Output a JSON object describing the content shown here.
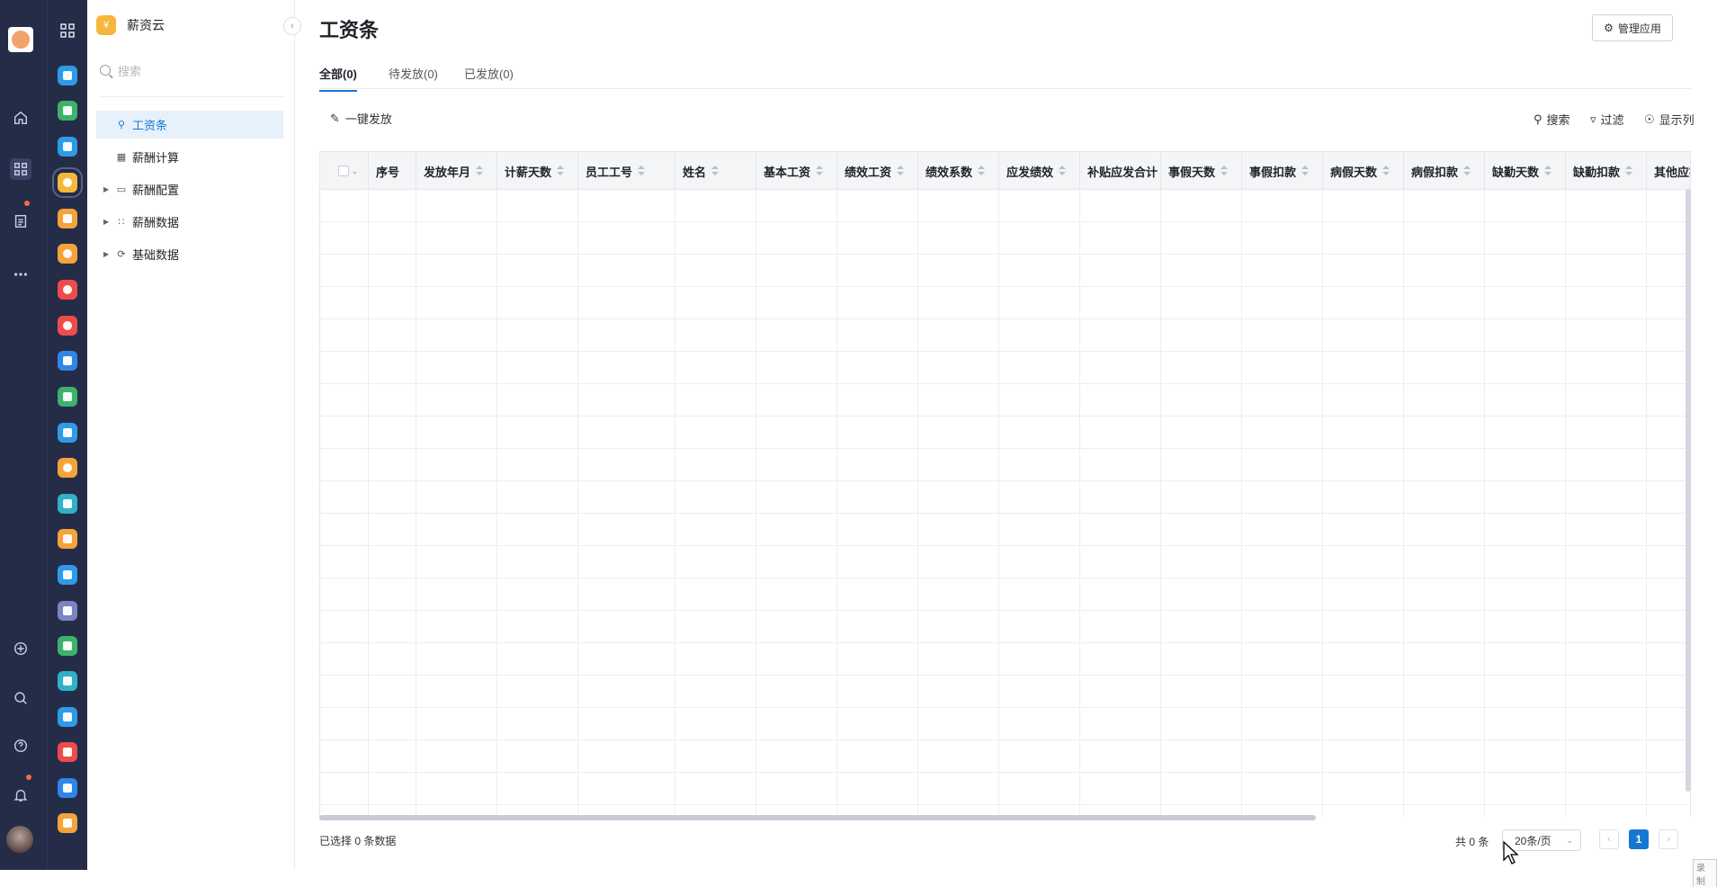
{
  "app": {
    "name": "薪资云",
    "logo_letter": "¥"
  },
  "sidebar": {
    "search_placeholder": "搜索",
    "items": [
      {
        "label": "工资条",
        "active": true,
        "icon": "circle-currency-icon"
      },
      {
        "label": "薪酬计算",
        "active": false,
        "icon": "calculator-icon"
      },
      {
        "label": "薪酬配置",
        "active": false,
        "icon": "config-icon",
        "expandable": true
      },
      {
        "label": "薪酬数据",
        "active": false,
        "icon": "data-icon",
        "expandable": true
      },
      {
        "label": "基础数据",
        "active": false,
        "icon": "refresh-icon",
        "expandable": true
      }
    ]
  },
  "page": {
    "title": "工资条",
    "manage_button": "管理应用",
    "tabs": [
      {
        "label": "全部(0)",
        "active": true
      },
      {
        "label": "待发放(0)",
        "active": false
      },
      {
        "label": "已发放(0)",
        "active": false
      }
    ],
    "one_click": "一键发放",
    "toolbar": {
      "search": "搜索",
      "filter": "过滤",
      "columns": "显示列"
    }
  },
  "table": {
    "headers": [
      "序号",
      "发放年月",
      "计薪天数",
      "员工工号",
      "姓名",
      "基本工资",
      "绩效工资",
      "绩效系数",
      "应发绩效",
      "补贴应发合计",
      "事假天数",
      "事假扣款",
      "病假天数",
      "病假扣款",
      "缺勤天数",
      "缺勤扣款",
      "其他应扣"
    ],
    "rows": []
  },
  "footer": {
    "selected": "已选择 0 条数据",
    "total": "共 0 条",
    "page_size": "20条/页",
    "current_page": "1"
  },
  "recording_label": "录制",
  "colors": {
    "accent": "#1677d2",
    "rail_bg": "#252c48"
  }
}
